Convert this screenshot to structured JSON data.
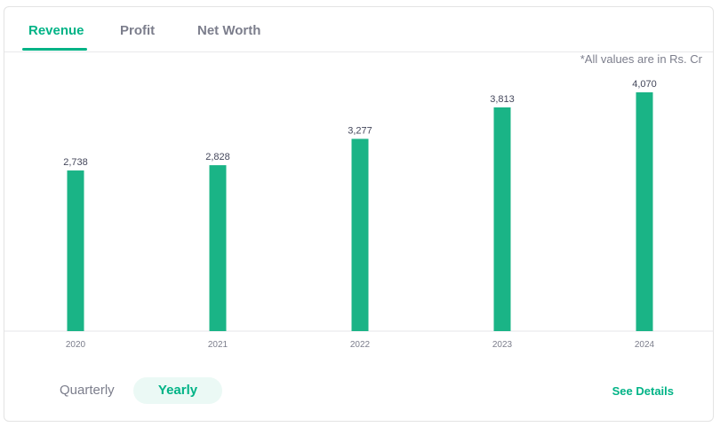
{
  "tabs": [
    {
      "label": "Revenue",
      "active": true
    },
    {
      "label": "Profit",
      "active": false
    },
    {
      "label": "Net Worth",
      "active": false
    }
  ],
  "note": "*All values are in Rs. Cr",
  "period_toggle": {
    "quarterly": "Quarterly",
    "yearly": "Yearly",
    "selected": "Yearly"
  },
  "see_details": "See Details",
  "colors": {
    "accent": "#00b386",
    "bar": "#1ab486"
  },
  "chart_data": {
    "type": "bar",
    "title": "",
    "xlabel": "",
    "ylabel": "",
    "categories": [
      "2020",
      "2021",
      "2022",
      "2023",
      "2024"
    ],
    "values": [
      2738,
      2828,
      3277,
      3813,
      4070
    ],
    "value_labels": [
      "2,738",
      "2,828",
      "3,277",
      "3,813",
      "4,070"
    ],
    "ylim": [
      0,
      4070
    ],
    "grid": false,
    "legend": "none"
  }
}
